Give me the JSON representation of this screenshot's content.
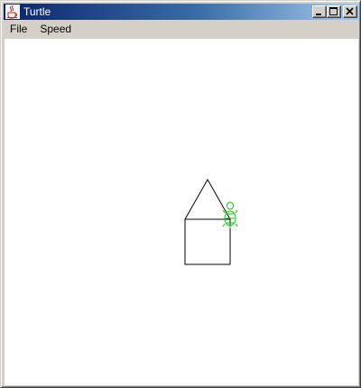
{
  "window": {
    "title": "Turtle",
    "icon": "java-cup-icon",
    "controls": [
      "minimize-icon",
      "maximize-icon",
      "close-icon"
    ]
  },
  "menubar": {
    "items": [
      {
        "label": "File"
      },
      {
        "label": "Speed"
      }
    ]
  },
  "canvas": {
    "background": "#ffffff",
    "drawing_color": "#000000",
    "turtle_color": "#00cc00",
    "turtle_icon": "turtle-icon"
  },
  "colors": {
    "titlebar_start": "#0a246a",
    "titlebar_end": "#a6caf0",
    "chrome": "#d4d0c8"
  }
}
